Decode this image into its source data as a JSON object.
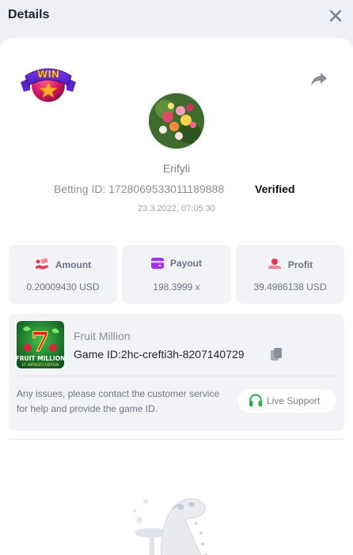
{
  "header": {
    "title": "Details"
  },
  "badge": {
    "text": "WIN"
  },
  "player": {
    "username": "Erifyli",
    "betting_id_label": "Betting ID:",
    "betting_id": "1728069533011189888",
    "verified": "Verified",
    "datetime": "23.3.2022, 07:05:30"
  },
  "stats": {
    "amount": {
      "label": "Amount",
      "value": "0.20009430 USD"
    },
    "payout": {
      "label": "Payout",
      "value": "198.3999 x"
    },
    "profit": {
      "label": "Profit",
      "value": "39.4986138 USD"
    }
  },
  "game": {
    "thumb_title": "FRUIT MILLION",
    "thumb_subtitle": "ST. PATRICK'S EDITION",
    "thumb_number": "7",
    "name": "Fruit Million",
    "id_label": "Game ID:",
    "id": "2hc-crefti3h-8207140729",
    "notice": "Any issues, please contact the customer service for help and provide the game ID.",
    "support_label": "Live Support"
  },
  "colors": {
    "page_bg": "#eef0f5",
    "card_bg": "#f2f3f7",
    "accent_red": "#e8374e",
    "payout_purple": "#a12ff0",
    "support_green": "#21b04b"
  }
}
